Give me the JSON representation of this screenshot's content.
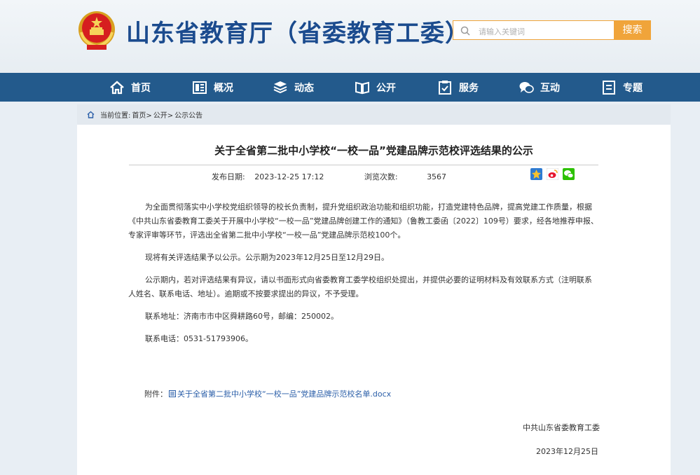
{
  "header": {
    "site_title": "山东省教育厅（省委教育工委）",
    "search_placeholder": "请输入关键词",
    "search_button": "搜索",
    "accent_color": "#f0a43a",
    "brand_color": "#1b4b8e"
  },
  "nav": {
    "items": [
      {
        "label": "首页",
        "icon": "home-icon"
      },
      {
        "label": "概况",
        "icon": "overview-icon"
      },
      {
        "label": "动态",
        "icon": "news-icon"
      },
      {
        "label": "公开",
        "icon": "book-icon"
      },
      {
        "label": "服务",
        "icon": "service-icon"
      },
      {
        "label": "互动",
        "icon": "chat-icon"
      },
      {
        "label": "专题",
        "icon": "topic-icon"
      }
    ],
    "bg_color": "#235a8c"
  },
  "breadcrumb": {
    "prefix": "当前位置:",
    "items": [
      "首页>",
      "公开>",
      "公示公告"
    ]
  },
  "article": {
    "title": "关于全省第二批中小学校“一校一品”党建品牌示范校评选结果的公示",
    "publish_label": "发布日期:",
    "publish_date": "2023-12-25 17:12",
    "views_label": "浏览次数:",
    "views_count": "3567",
    "paragraphs": [
      "为全面贯彻落实中小学校党组织领导的校长负责制，提升党组织政治功能和组织功能，打造党建特色品牌，提高党建工作质量，根据《中共山东省委教育工委关于开展中小学校“一校一品”党建品牌创建工作的通知》（鲁教工委函〔2022〕109号）要求，经各地推荐申报、专家评审等环节，评选出全省第二批中小学校“一校一品”党建品牌示范校100个。",
      "现将有关评选结果予以公示。公示期为2023年12月25日至12月29日。",
      "公示期内，若对评选结果有异议，请以书面形式向省委教育工委学校组织处提出，并提供必要的证明材料及有效联系方式（注明联系人姓名、联系电话、地址）。逾期或不按要求提出的异议，不予受理。",
      "联系地址：济南市市中区舜耕路60号，邮编：250002。",
      "联系电话：0531-51793906。"
    ],
    "attachment_label": "附件：",
    "attachment_name": "关于全省第二批中小学校“一校一品”党建品牌示范校名单.docx",
    "signature": "中共山东省委教育工委",
    "sign_date": "2023年12月25日"
  }
}
